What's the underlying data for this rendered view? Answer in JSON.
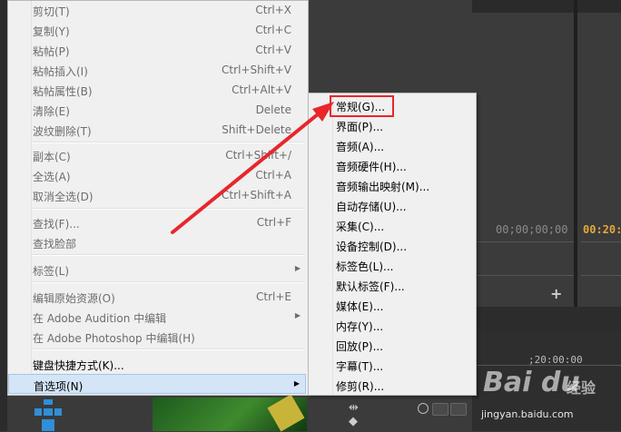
{
  "edit_menu": {
    "items": [
      {
        "label": "剪切(T)",
        "shortcut": "Ctrl+X",
        "enabled": false,
        "submenu": false
      },
      {
        "label": "复制(Y)",
        "shortcut": "Ctrl+C",
        "enabled": false,
        "submenu": false
      },
      {
        "label": "粘帖(P)",
        "shortcut": "Ctrl+V",
        "enabled": false,
        "submenu": false
      },
      {
        "label": "粘帖插入(I)",
        "shortcut": "Ctrl+Shift+V",
        "enabled": false,
        "submenu": false
      },
      {
        "label": "粘帖属性(B)",
        "shortcut": "Ctrl+Alt+V",
        "enabled": false,
        "submenu": false
      },
      {
        "label": "清除(E)",
        "shortcut": "Delete",
        "enabled": false,
        "submenu": false
      },
      {
        "label": "波纹删除(T)",
        "shortcut": "Shift+Delete",
        "enabled": false,
        "submenu": false
      },
      {
        "label": "副本(C)",
        "shortcut": "Ctrl+Shift+/",
        "enabled": false,
        "submenu": false
      },
      {
        "label": "全选(A)",
        "shortcut": "Ctrl+A",
        "enabled": false,
        "submenu": false
      },
      {
        "label": "取消全选(D)",
        "shortcut": "Ctrl+Shift+A",
        "enabled": false,
        "submenu": false
      },
      {
        "label": "查找(F)...",
        "shortcut": "Ctrl+F",
        "enabled": false,
        "submenu": false
      },
      {
        "label": "查找脸部",
        "shortcut": "",
        "enabled": false,
        "submenu": false
      },
      {
        "label": "标签(L)",
        "shortcut": "",
        "enabled": false,
        "submenu": true
      },
      {
        "label": "编辑原始资源(O)",
        "shortcut": "Ctrl+E",
        "enabled": false,
        "submenu": false
      },
      {
        "label": "在 Adobe Audition 中编辑",
        "shortcut": "",
        "enabled": false,
        "submenu": true
      },
      {
        "label": "在 Adobe Photoshop 中编辑(H)",
        "shortcut": "",
        "enabled": false,
        "submenu": false
      },
      {
        "label": "键盘快捷方式(K)...",
        "shortcut": "",
        "enabled": true,
        "submenu": false
      },
      {
        "label": "首选项(N)",
        "shortcut": "",
        "enabled": true,
        "submenu": true,
        "highlighted": true
      }
    ]
  },
  "preferences_submenu": {
    "items": [
      "常规(G)...",
      "界面(P)...",
      "音频(A)...",
      "音频硬件(H)...",
      "音频输出映射(M)...",
      "自动存储(U)...",
      "采集(C)...",
      "设备控制(D)...",
      "标签色(L)...",
      "默认标签(F)...",
      "媒体(E)...",
      "内存(Y)...",
      "回放(P)...",
      "字幕(T)...",
      "修剪(R)..."
    ]
  },
  "background": {
    "timecode_source": "00;00;00;00",
    "timecode_program": "00:20:",
    "timeline_time": ";20:00:00",
    "watermark_brand": "Bai du",
    "watermark_sub": "经验",
    "watermark_url": "jingyan.baidu.com"
  },
  "colors": {
    "highlight_box": "#e8262b",
    "arrow": "#e8262b",
    "timecode_active": "#e3a93b"
  }
}
